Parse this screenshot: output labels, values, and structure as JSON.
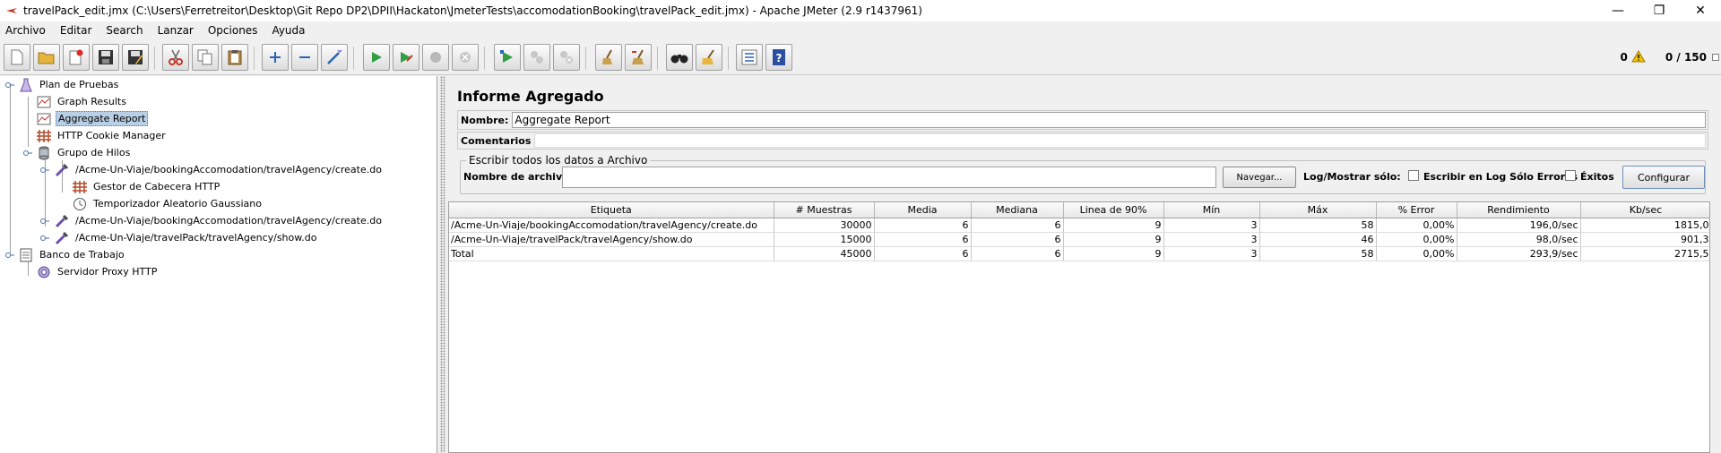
{
  "window": {
    "title": "travelPack_edit.jmx (C:\\Users\\Ferretreitor\\Desktop\\Git Repo DP2\\DPII\\Hackaton\\JmeterTests\\accomodationBooking\\travelPack_edit.jmx) - Apache JMeter (2.9 r1437961)",
    "minimize": "—",
    "restore": "❐",
    "close": "✕"
  },
  "menu": [
    "Archivo",
    "Editar",
    "Search",
    "Lanzar",
    "Opciones",
    "Ayuda"
  ],
  "status": {
    "errors": "0",
    "threads": "0 / 150"
  },
  "tree": {
    "nodes": [
      "Plan de Pruebas",
      "Graph Results",
      "Aggregate Report",
      "HTTP Cookie Manager",
      "Grupo de Hilos",
      "/Acme-Un-Viaje/bookingAccomodation/travelAgency/create.do",
      "Gestor de Cabecera HTTP",
      "Temporizador Aleatorio Gaussiano",
      "/Acme-Un-Viaje/bookingAccomodation/travelAgency/create.do",
      "/Acme-Un-Viaje/travelPack/travelAgency/show.do",
      "Banco de Trabajo",
      "Servidor Proxy HTTP"
    ]
  },
  "panel": {
    "title": "Informe Agregado",
    "name_label": "Nombre:",
    "name_value": "Aggregate Report",
    "comments_label": "Comentarios",
    "file_section": "Escribir todos los datos a Archivo",
    "file_label": "Nombre de archivo",
    "browse_button": "Navegar...",
    "log_label": "Log/Mostrar sólo:",
    "errors_only_label": "Escribir en Log Sólo Errores",
    "success_label": "Éxitos",
    "configure_button": "Configurar"
  },
  "table": {
    "columns": [
      "Etiqueta",
      "# Muestras",
      "Media",
      "Mediana",
      "Linea de 90%",
      "Mín",
      "Máx",
      "% Error",
      "Rendimiento",
      "Kb/sec"
    ],
    "rows": [
      [
        "/Acme-Un-Viaje/bookingAccomodation/travelAgency/create.do",
        "30000",
        "6",
        "6",
        "9",
        "3",
        "58",
        "0,00%",
        "196,0/sec",
        "1815,0"
      ],
      [
        "/Acme-Un-Viaje/travelPack/travelAgency/show.do",
        "15000",
        "6",
        "6",
        "9",
        "3",
        "46",
        "0,00%",
        "98,0/sec",
        "901,3"
      ],
      [
        "Total",
        "45000",
        "6",
        "6",
        "9",
        "3",
        "58",
        "0,00%",
        "293,9/sec",
        "2715,5"
      ]
    ]
  }
}
